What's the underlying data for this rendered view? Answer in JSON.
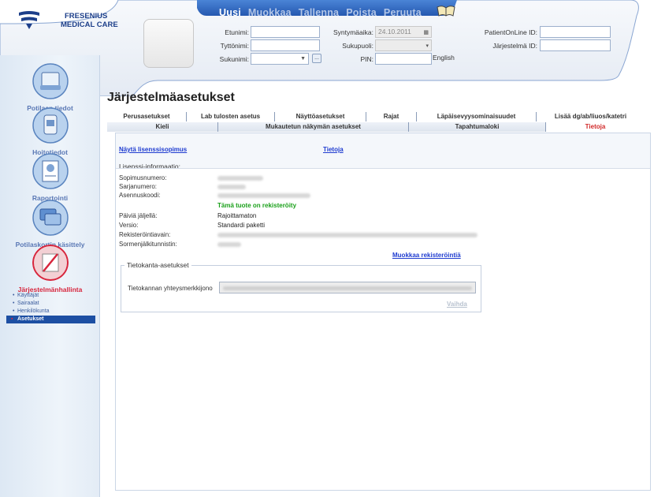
{
  "brand": {
    "line1": "FRESENIUS",
    "line2": "MEDICAL CARE",
    "color": "#1d3f8a"
  },
  "toolbar": {
    "buttons": [
      {
        "label": "Uusi",
        "enabled": true
      },
      {
        "label": "Muokkaa",
        "enabled": false
      },
      {
        "label": "Tallenna",
        "enabled": false
      },
      {
        "label": "Poista",
        "enabled": false
      },
      {
        "label": "Peruuta",
        "enabled": false
      }
    ],
    "help_icon": "book-icon"
  },
  "patient_form": {
    "first_name": {
      "label": "Etunimi:",
      "value": ""
    },
    "maiden_name": {
      "label": "Tyttönimi:",
      "value": ""
    },
    "last_name": {
      "label": "Sukunimi:",
      "value": ""
    },
    "birth_date": {
      "label": "Syntymäaika:",
      "value": "24.10.2011"
    },
    "gender": {
      "label": "Sukupuoli:",
      "value": ""
    },
    "pin": {
      "label": "PIN:",
      "value": ""
    },
    "patient_online_id": {
      "label": "PatientOnLine ID:",
      "value": ""
    },
    "system_id": {
      "label": "Järjestelmä ID:",
      "value": ""
    },
    "language": "English",
    "more_button": "..."
  },
  "sidebar": {
    "items": [
      {
        "label": "Potilaan tiedot",
        "icon": "patient-info-icon",
        "active": false
      },
      {
        "label": "Hoitotiedot",
        "icon": "treatment-icon",
        "active": false
      },
      {
        "label": "Raportointi",
        "icon": "reports-icon",
        "active": false
      },
      {
        "label": "Potilaskortin käsittely",
        "icon": "patient-card-icon",
        "active": false
      },
      {
        "label": "Järjestelmänhallinta",
        "icon": "system-admin-icon",
        "active": true
      }
    ],
    "sub_items": [
      {
        "label": "Käyttäjät",
        "active": false
      },
      {
        "label": "Sairaalat",
        "active": false
      },
      {
        "label": "Henkilökunta",
        "active": false
      },
      {
        "label": "Asetukset",
        "active": true
      }
    ]
  },
  "main": {
    "title": "Järjestelmäasetukset",
    "tabs_row1": [
      "Perusasetukset",
      "Lab tulosten asetus",
      "Näyttöasetukset",
      "Rajat",
      "Läpäisevyysominaisuudet",
      "Lisää dg/ab/liuos/katetri"
    ],
    "tabs_row2": [
      {
        "label": "Kieli",
        "active": false
      },
      {
        "label": "Mukautetun näkymän asetukset",
        "active": false
      },
      {
        "label": "Tapahtumaloki",
        "active": false
      },
      {
        "label": "Tietoja",
        "active": true
      }
    ],
    "links": {
      "show_license": "Näytä lisenssisopimus",
      "about": "Tietoja"
    },
    "license_section": "Lisenssi-informaatio:",
    "license_rows": [
      {
        "label": "Sopimusnumero:",
        "value": null
      },
      {
        "label": "Sarjanumero:",
        "value": null
      },
      {
        "label": "Asennuskoodi:",
        "value": null
      },
      {
        "label": "Päiviä jäljellä:",
        "value": "Rajoittamaton"
      },
      {
        "label": "Versio:",
        "value": "Standardi paketti"
      },
      {
        "label": "Rekisteröintiavain:",
        "value": null
      },
      {
        "label": "Sormenjälkitunnistin:",
        "value": null
      }
    ],
    "registered_msg": "Tämä tuote on rekisteröity",
    "edit_registration": "Muokkaa rekisteröintiä",
    "db_settings": {
      "legend": "Tietokanta-asetukset",
      "conn_label": "Tietokannan yhteysmerkkijono",
      "change_label": "Vaihda"
    }
  },
  "colors": {
    "accent": "#d7263d",
    "link": "#1f3cd0",
    "header_blue": "#2d63b8",
    "success": "#1aa01a"
  }
}
